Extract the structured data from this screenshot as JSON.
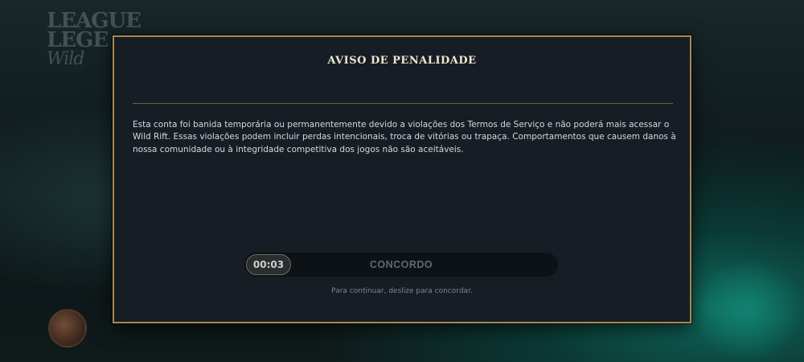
{
  "background": {
    "logo_line1": "LEAGUE",
    "logo_line2": "LEGE",
    "logo_sub": "Wild"
  },
  "modal": {
    "title": "AVISO DE PENALIDADE",
    "message": "Esta conta foi banida temporária ou permanentemente devido a violações dos Termos de Serviço e não poderá mais acessar o Wild Rift. Essas violações podem incluir perdas intencionais, troca de vitórias ou trapaça. Comportamentos que causem danos à nossa comunidade ou à integridade competitiva dos jogos não são aceitáveis.",
    "slider": {
      "timer": "00:03",
      "label": "CONCORDO"
    },
    "hint": "Para continuar, deslize para concordar."
  },
  "colors": {
    "modal_bg": "#161d24",
    "border_gold": "#a8894f",
    "title": "#efe6cf"
  }
}
